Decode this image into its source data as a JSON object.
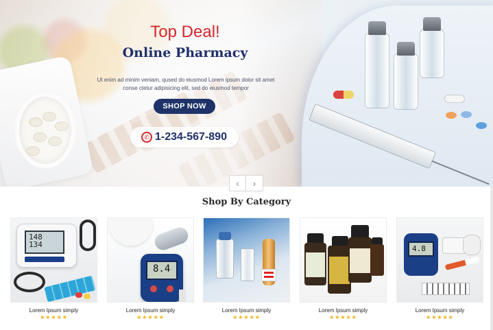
{
  "hero": {
    "title": "Top Deal!",
    "subtitle": "Online Pharmacy",
    "description": "Ut enim ad minim veniam, qused do eiusmod  Lorem ipsum dolor sit amet conse ctetur adipisicing elit, sed do eiusmod tempor",
    "cta_label": "SHOP NOW",
    "phone": "1-234-567-890",
    "prev_arrow": "‹",
    "next_arrow": "›"
  },
  "category_section": {
    "title": "Shop By Category",
    "items": [
      {
        "name": "Lorem Ipsum simply",
        "rating": 5,
        "stars": "★★★★★",
        "image": "blood-pressure-monitor"
      },
      {
        "name": "Lorem Ipsum simply",
        "rating": 5,
        "stars": "★★★★★",
        "image": "glucose-meter"
      },
      {
        "name": "Lorem Ipsum simply",
        "rating": 5,
        "stars": "★★★★★",
        "image": "vials"
      },
      {
        "name": "Lorem Ipsum simply",
        "rating": 5,
        "stars": "★★★★★",
        "image": "essential-oils"
      },
      {
        "name": "Lorem Ipsum simply",
        "rating": 5,
        "stars": "★★★★★",
        "image": "glucose-test-kit"
      }
    ]
  },
  "colors": {
    "accent_red": "#d8252b",
    "navy": "#1f3368",
    "star": "#f1b10f"
  }
}
